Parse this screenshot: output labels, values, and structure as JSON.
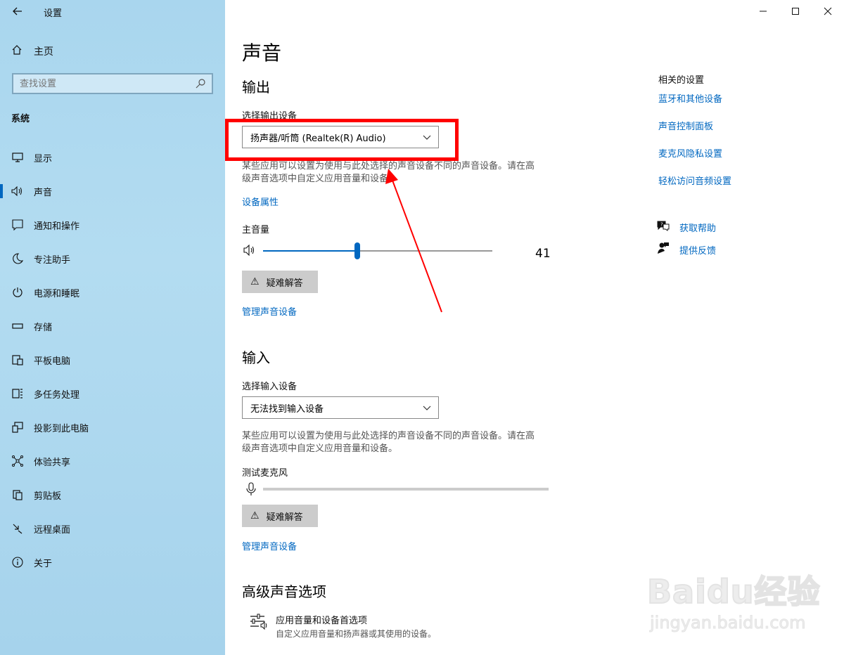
{
  "window": {
    "title": "设置"
  },
  "sidebar": {
    "home_label": "主页",
    "search_placeholder": "查找设置",
    "section_label": "系统",
    "items": [
      {
        "label": "显示",
        "icon": "display-icon"
      },
      {
        "label": "声音",
        "icon": "speaker-icon",
        "active": true
      },
      {
        "label": "通知和操作",
        "icon": "notification-icon"
      },
      {
        "label": "专注助手",
        "icon": "moon-icon"
      },
      {
        "label": "电源和睡眠",
        "icon": "power-icon"
      },
      {
        "label": "存储",
        "icon": "storage-icon"
      },
      {
        "label": "平板电脑",
        "icon": "tablet-icon"
      },
      {
        "label": "多任务处理",
        "icon": "multitask-icon"
      },
      {
        "label": "投影到此电脑",
        "icon": "project-icon"
      },
      {
        "label": "体验共享",
        "icon": "share-icon"
      },
      {
        "label": "剪贴板",
        "icon": "clipboard-icon"
      },
      {
        "label": "远程桌面",
        "icon": "remote-desktop-icon"
      },
      {
        "label": "关于",
        "icon": "info-icon"
      }
    ]
  },
  "main": {
    "page_title": "声音",
    "output": {
      "heading": "输出",
      "select_label": "选择输出设备",
      "selected_device": "扬声器/听筒 (Realtek(R) Audio)",
      "desc_line1": "某些应用可以设置为使用与此处选择的声音设备不同的声音设备。请在高",
      "desc_line2": "级声音选项中自定义应用音量和设备。",
      "device_props_link": "设备属性",
      "volume_label": "主音量",
      "volume_value": "41",
      "troubleshoot_label": "疑难解答",
      "manage_link": "管理声音设备"
    },
    "input": {
      "heading": "输入",
      "select_label": "选择输入设备",
      "selected_device": "无法找到输入设备",
      "desc_line1": "某些应用可以设置为使用与此处选择的声音设备不同的声音设备。请在高",
      "desc_line2": "级声音选项中自定义应用音量和设备。",
      "test_mic_label": "测试麦克风",
      "troubleshoot_label": "疑难解答",
      "manage_link": "管理声音设备"
    },
    "advanced": {
      "heading": "高级声音选项",
      "item_title": "应用音量和设备首选项",
      "item_sub": "自定义应用音量和扬声器或其使用的设备。"
    }
  },
  "related": {
    "title": "相关的设置",
    "links": [
      "蓝牙和其他设备",
      "声音控制面板",
      "麦克风隐私设置",
      "轻松访问音频设置"
    ],
    "help_label": "获取帮助",
    "feedback_label": "提供反馈"
  },
  "watermark": {
    "logo": "Baidu经验",
    "url": "jingyan.baidu.com"
  },
  "colors": {
    "accent": "#0067c0",
    "annotation": "#ff0000",
    "sidebar_bg": "#a9d6ee"
  }
}
